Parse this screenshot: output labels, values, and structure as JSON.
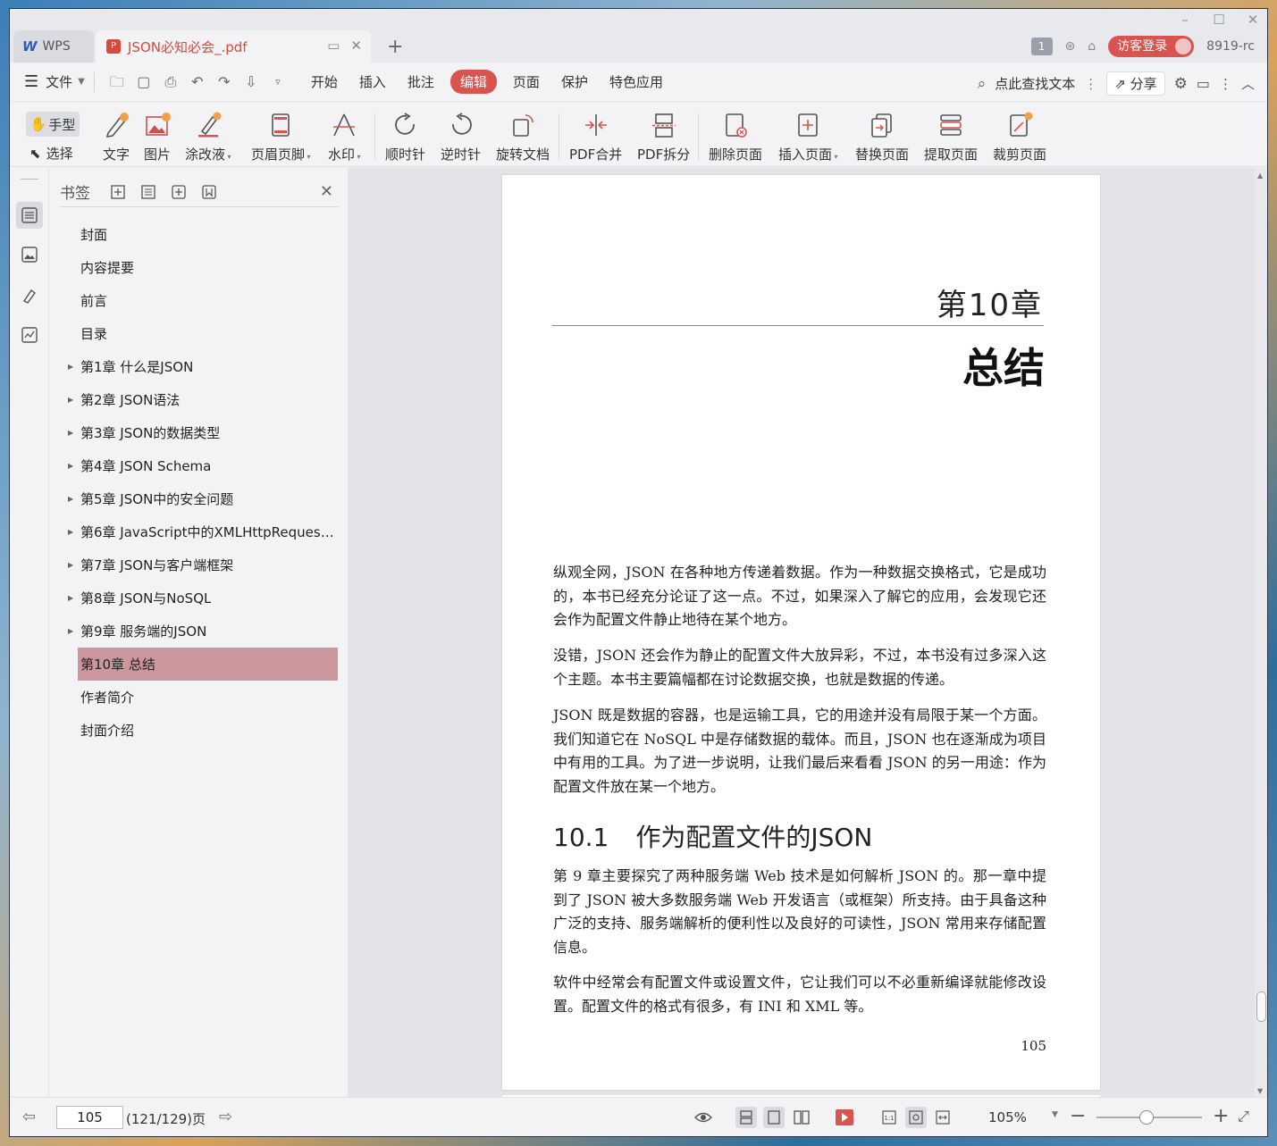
{
  "titlebar": {
    "app_tab": "WPS",
    "doc_tab": "JSON必知必会_.pdf",
    "page_badge": "1",
    "login_label": "访客登录",
    "version_text": "8919-rc"
  },
  "menubar": {
    "file_label": "文件",
    "tabs": [
      "开始",
      "插入",
      "批注",
      "编辑",
      "页面",
      "保护",
      "特色应用"
    ],
    "active_tab": "编辑",
    "search_label": "点此查找文本",
    "share_label": "分享"
  },
  "ribbon": {
    "hand_label": "手型",
    "select_label": "选择",
    "tools": [
      "文字",
      "图片",
      "涂改液",
      "页眉页脚",
      "水印",
      "顺时针",
      "逆时针",
      "旋转文档",
      "PDF合并",
      "PDF拆分",
      "删除页面",
      "插入页面",
      "替换页面",
      "提取页面",
      "裁剪页面"
    ]
  },
  "bookmarks": {
    "title": "书签",
    "items": [
      {
        "label": "封面",
        "expandable": false
      },
      {
        "label": "内容提要",
        "expandable": false
      },
      {
        "label": "前言",
        "expandable": false
      },
      {
        "label": "目录",
        "expandable": false
      },
      {
        "label": "第1章 什么是JSON",
        "expandable": true
      },
      {
        "label": "第2章 JSON语法",
        "expandable": true
      },
      {
        "label": "第3章 JSON的数据类型",
        "expandable": true
      },
      {
        "label": "第4章 JSON Schema",
        "expandable": true
      },
      {
        "label": "第5章 JSON中的安全问题",
        "expandable": true
      },
      {
        "label": "第6章 JavaScript中的XMLHttpRequest...",
        "expandable": true
      },
      {
        "label": "第7章 JSON与客户端框架",
        "expandable": true
      },
      {
        "label": "第8章 JSON与NoSQL",
        "expandable": true
      },
      {
        "label": "第9章 服务端的JSON",
        "expandable": true
      },
      {
        "label": "第10章 总结",
        "expandable": true,
        "selected": true
      },
      {
        "label": "作者简介",
        "expandable": false
      },
      {
        "label": "封面介绍",
        "expandable": false
      }
    ]
  },
  "page": {
    "chapter_number": "第10章",
    "chapter_title": "总结",
    "paragraphs": [
      "纵观全网，JSON 在各种地方传递着数据。作为一种数据交换格式，它是成功的，本书已经充分论证了这一点。不过，如果深入了解它的应用，会发现它还会作为配置文件静止地待在某个地方。",
      "没错，JSON 还会作为静止的配置文件大放异彩，不过，本书没有过多深入这个主题。本书主要篇幅都在讨论数据交换，也就是数据的传递。",
      "JSON 既是数据的容器，也是运输工具，它的用途并没有局限于某一个方面。我们知道它在 NoSQL 中是存储数据的载体。而且，JSON 也在逐渐成为项目中有用的工具。为了进一步说明，让我们最后来看看 JSON 的另一用途：作为配置文件放在某一个地方。"
    ],
    "section_number": "10.1",
    "section_title": "作为配置文件的JSON",
    "section_paragraphs": [
      "第 9 章主要探究了两种服务端 Web 技术是如何解析 JSON 的。那一章中提到了 JSON 被大多数服务端 Web 开发语言（或框架）所支持。由于具备这种广泛的支持、服务端解析的便利性以及良好的可读性，JSON 常用来存储配置信息。",
      "软件中经常会有配置文件或设置文件，它让我们可以不必重新编译就能修改设置。配置文件的格式有很多，有 INI 和 XML 等。"
    ],
    "page_number": "105"
  },
  "statusbar": {
    "current_page": "105",
    "page_total": "(121/129)页",
    "zoom": "105%"
  },
  "colors": {
    "accent": "#d9534f",
    "selected_bookmark": "#c9979c"
  }
}
